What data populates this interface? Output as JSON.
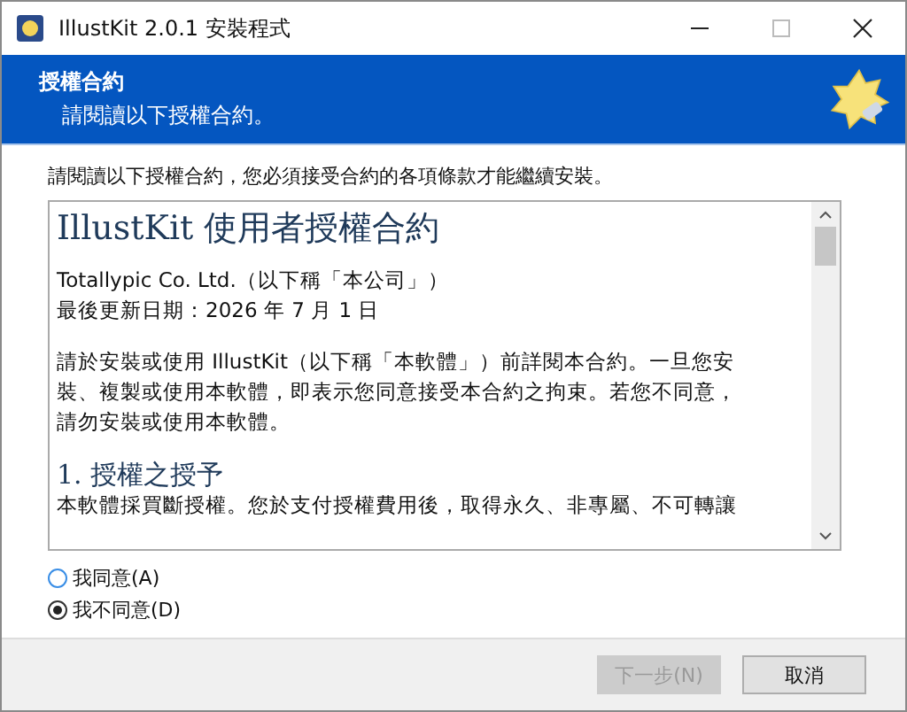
{
  "window": {
    "title": "IllustKit 2.0.1 安裝程式"
  },
  "header": {
    "title": "授權合約",
    "subtitle": "請閱讀以下授權合約。"
  },
  "instruction": "請閱讀以下授權合約，您必須接受合約的各項條款才能繼續安裝。",
  "license": [
    {
      "kind": "title",
      "lines": [
        "IllustKit 使用者授權合約"
      ]
    },
    {
      "kind": "text",
      "lines": [
        "Totallypic Co. Ltd.（以下稱「本公司」）",
        "最後更新日期：2026 年 7 月 1 日"
      ]
    },
    {
      "kind": "text",
      "lines": [
        "請於安裝或使用 IllustKit（以下稱「本軟體」）前詳閱本合約。一旦您安",
        "裝、複製或使用本軟體，即表示您同意接受本合約之拘束。若您不同意，",
        "請勿安裝或使用本軟體。"
      ]
    },
    {
      "kind": "heading",
      "lines": [
        "1. 授權之授予"
      ]
    },
    {
      "kind": "text",
      "lines": [
        "本軟體採買斷授權。您於支付授權費用後，取得永久、非專屬、不可轉讓"
      ]
    }
  ],
  "options": [
    {
      "label": "我同意(A)",
      "selected": false
    },
    {
      "label": "我不同意(D)",
      "selected": true
    }
  ],
  "buttons": [
    {
      "label": "下一步(N)",
      "disabled": true
    },
    {
      "label": "取消",
      "disabled": false
    }
  ]
}
